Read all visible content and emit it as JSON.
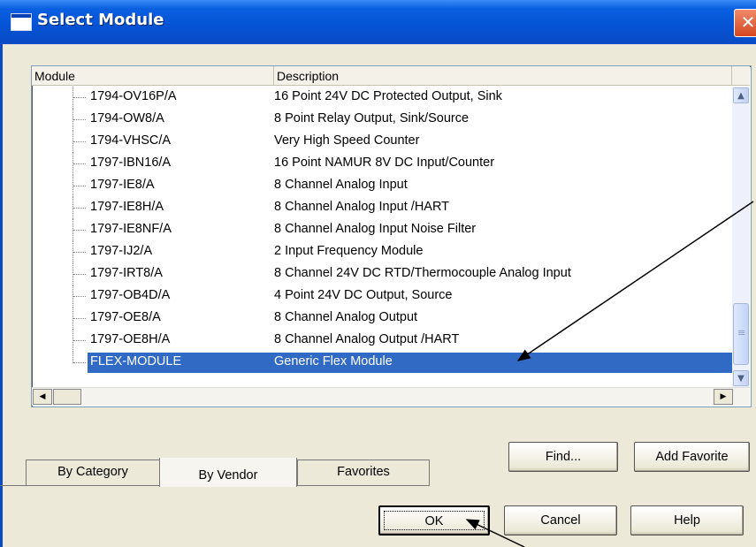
{
  "window": {
    "title": "Select Module",
    "close_label": "✕"
  },
  "list": {
    "columns": [
      "Module",
      "Description"
    ],
    "rows": [
      {
        "module": "1794-OV16P/A",
        "description": "16 Point 24V DC Protected Output, Sink"
      },
      {
        "module": "1794-OW8/A",
        "description": "8 Point Relay Output, Sink/Source"
      },
      {
        "module": "1794-VHSC/A",
        "description": "Very High Speed Counter"
      },
      {
        "module": "1797-IBN16/A",
        "description": "16 Point NAMUR 8V DC Input/Counter"
      },
      {
        "module": "1797-IE8/A",
        "description": "8 Channel Analog Input"
      },
      {
        "module": "1797-IE8H/A",
        "description": "8 Channel Analog Input /HART"
      },
      {
        "module": "1797-IE8NF/A",
        "description": "8 Channel Analog Input Noise Filter"
      },
      {
        "module": "1797-IJ2/A",
        "description": "2 Input Frequency Module"
      },
      {
        "module": "1797-IRT8/A",
        "description": "8 Channel 24V DC RTD/Thermocouple Analog Input"
      },
      {
        "module": "1797-OB4D/A",
        "description": "4 Point 24V DC Output, Source"
      },
      {
        "module": "1797-OE8/A",
        "description": "8 Channel Analog Output"
      },
      {
        "module": "1797-OE8H/A",
        "description": "8 Channel Analog Output /HART"
      },
      {
        "module": "FLEX-MODULE",
        "description": "Generic Flex Module",
        "selected": true
      }
    ],
    "selection_color": "#316ac5"
  },
  "buttons": {
    "find": "Find...",
    "add_favorite": "Add Favorite",
    "ok": "OK",
    "cancel": "Cancel",
    "help": "Help"
  },
  "tabs": [
    {
      "label": "By Category"
    },
    {
      "label": "By Vendor",
      "active": true
    },
    {
      "label": "Favorites"
    }
  ],
  "colors": {
    "titlebar": "#0553d4",
    "dialog": "#ece9d8",
    "annotation_arrows": "#000000"
  }
}
